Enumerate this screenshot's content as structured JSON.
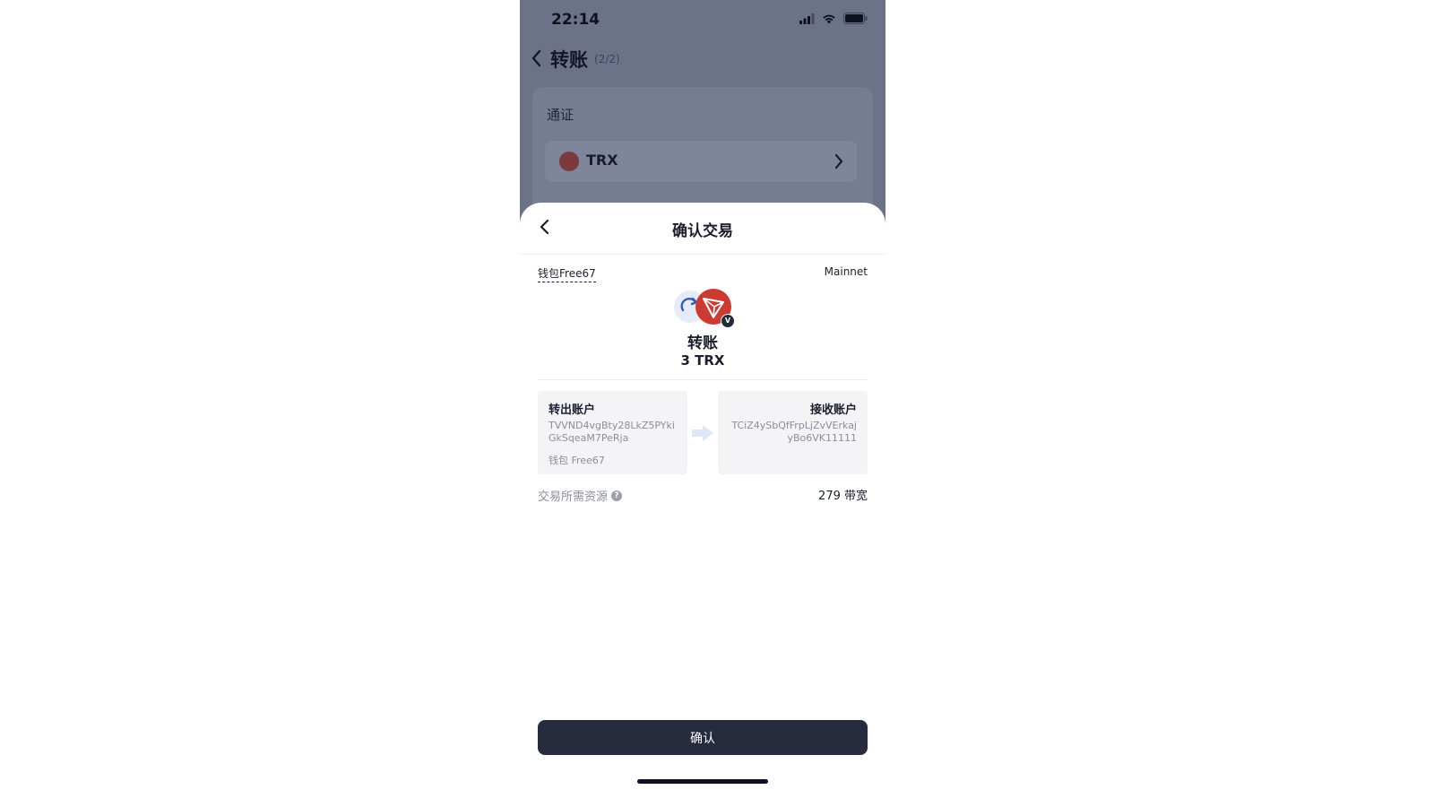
{
  "status_bar": {
    "time": "22:14"
  },
  "background_page": {
    "title": "转账",
    "step": "(2/2)",
    "token_section_label": "通证",
    "selected_token": "TRX",
    "overlay_color": "#6c7389"
  },
  "sheet": {
    "title": "确认交易",
    "wallet": "钱包Free67",
    "network": "Mainnet",
    "tx_type": "转账",
    "amount": "3 TRX",
    "verify_badge": "V",
    "from": {
      "title": "转出账户",
      "address": "TVVND4vgBty28LkZ5PYkiGkSqeaM7PeRja",
      "wallet": "钱包 Free67"
    },
    "to": {
      "title": "接收账户",
      "address": "TCiZ4ySbQfFrpLjZvVErkajyBo6VK11111"
    },
    "resource_label": "交易所需资源",
    "resource_help": "?",
    "resource_value": "279 带宽",
    "confirm_label": "确认"
  },
  "colors": {
    "primary_button": "#262c3e",
    "trx_red": "#cc3a31",
    "muted_text": "#8a8e98"
  }
}
